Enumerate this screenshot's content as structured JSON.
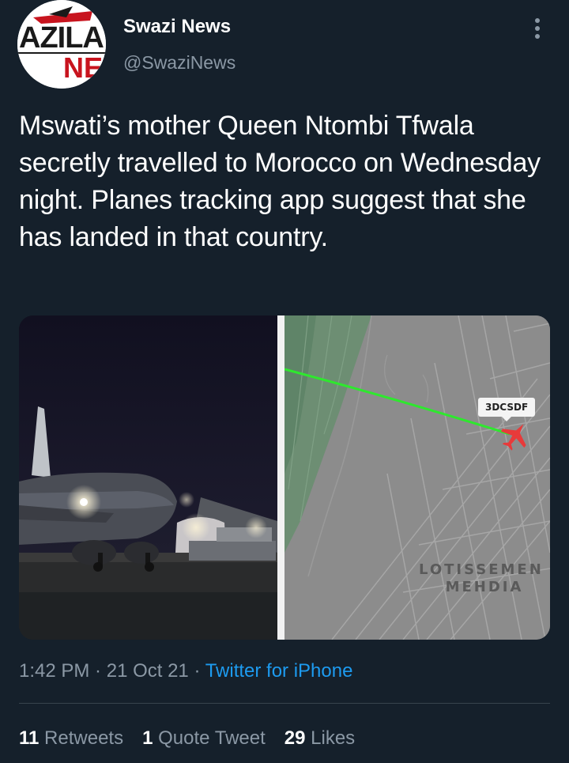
{
  "header": {
    "display_name": "Swazi News",
    "handle": "@SwaziNews",
    "avatar_logo_text": "AZILA NE",
    "more_icon": "more-vertical-icon"
  },
  "tweet": {
    "text": "Mswati’s mother Queen Ntombi Tfwala secretly travelled to Morocco on Wednesday night. Planes tracking app suggest that she has landed in that country."
  },
  "media": {
    "flight_badge": "3DCSDF",
    "map_label_line1": "LOTISSEMEN",
    "map_label_line2": "MEHDIA",
    "plane_icon": "airplane-icon",
    "colors": {
      "track": "#2ee82e",
      "plane": "#e83a3a",
      "map_bg": "#8c8c8c"
    }
  },
  "meta": {
    "time": "1:42 PM",
    "separator1": " · ",
    "date": "21 Oct 21",
    "separator2": " · ",
    "source": "Twitter for iPhone"
  },
  "stats": {
    "retweets_count": "11",
    "retweets_label": "Retweets",
    "quotes_count": "1",
    "quotes_label": "Quote Tweet",
    "likes_count": "29",
    "likes_label": "Likes"
  },
  "colors": {
    "background": "#15202b",
    "secondary_text": "#8b98a5",
    "link": "#1d9bf0",
    "divider": "#38444d"
  }
}
